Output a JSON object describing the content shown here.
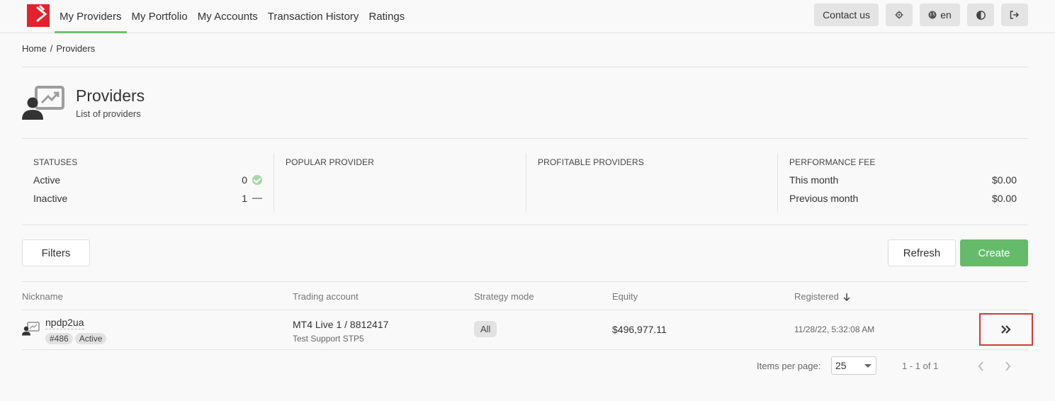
{
  "nav": {
    "items": [
      "My Providers",
      "My Portfolio",
      "My Accounts",
      "Transaction History",
      "Ratings"
    ],
    "active": "My Providers"
  },
  "top_actions": {
    "contact": "Contact us",
    "language": "en"
  },
  "breadcrumb": {
    "home": "Home",
    "separator": "/",
    "current": "Providers"
  },
  "header": {
    "title": "Providers",
    "subtitle": "List of providers"
  },
  "stats": {
    "statuses": {
      "title": "STATUSES",
      "active_label": "Active",
      "active_count": "0",
      "inactive_label": "Inactive",
      "inactive_count": "1"
    },
    "popular_title": "POPULAR PROVIDER",
    "profitable_title": "PROFITABLE PROVIDERS",
    "fee": {
      "title": "PERFORMANCE FEE",
      "this_month_label": "This month",
      "this_month_value": "$0.00",
      "prev_month_label": "Previous month",
      "prev_month_value": "$0.00"
    }
  },
  "toolbar": {
    "filters": "Filters",
    "refresh": "Refresh",
    "create": "Create"
  },
  "table": {
    "headers": {
      "nickname": "Nickname",
      "account": "Trading account",
      "mode": "Strategy mode",
      "equity": "Equity",
      "registered": "Registered"
    },
    "rows": [
      {
        "nickname": "npdp2ua",
        "id": "#486",
        "status": "Active",
        "account": "MT4 Live 1 / 8812417",
        "server": "Test Support STP5",
        "mode": "All",
        "equity": "$496,977.11",
        "registered": "11/28/22, 5:32:08 AM"
      }
    ]
  },
  "pagination": {
    "items_label": "Items per page:",
    "per_page": "25",
    "range": "1 - 1 of 1"
  },
  "colors": {
    "accent_green": "#66bb6a",
    "logo_red": "#e4222b",
    "highlight_red": "#d23a3a"
  }
}
